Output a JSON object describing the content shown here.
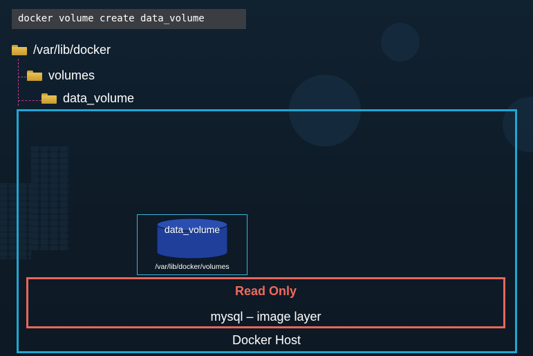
{
  "command": "docker volume create data_volume",
  "tree": {
    "root": "/var/lib/docker",
    "child": "volumes",
    "grandchild": "data_volume"
  },
  "volume": {
    "name": "data_volume",
    "path": "/var/lib/docker/volumes"
  },
  "image_layer": {
    "badge": "Read Only",
    "label": "mysql – image layer"
  },
  "host": {
    "label": "Docker Host"
  },
  "colors": {
    "host_border": "#1ea7d4",
    "read_only": "#f06a5c",
    "image_layer_border": "#e8675a",
    "volume_fill": "#1f3f9a",
    "tree_connector": "#c13a8a",
    "folder": "#e8c257"
  },
  "icons": [
    "folder-icon",
    "cylinder-volume-icon"
  ]
}
